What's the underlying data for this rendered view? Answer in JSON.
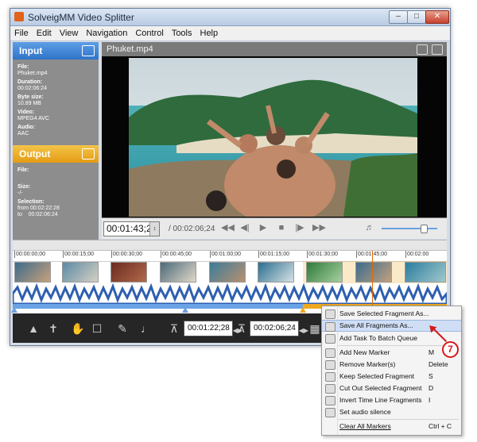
{
  "window": {
    "title": "SolveigMM Video Splitter"
  },
  "menu": [
    "File",
    "Edit",
    "View",
    "Navigation",
    "Control",
    "Tools",
    "Help"
  ],
  "input_panel": {
    "header": "Input",
    "fields": [
      {
        "label": "File:",
        "value": "Phuket.mp4"
      },
      {
        "label": "Duration:",
        "value": "00:02:06:24"
      },
      {
        "label": "Byte size:",
        "value": "10.89 MB"
      },
      {
        "label": "Video:",
        "value": "MPEG4 AVC"
      },
      {
        "label": "Audio:",
        "value": "AAC"
      }
    ]
  },
  "output_panel": {
    "header": "Output",
    "file_label": "File:",
    "size_label": "Size:",
    "size_value": "-/-",
    "selection_label": "Selection:",
    "from_label": "from",
    "from_value": "00:02:22:28",
    "to_label": "to",
    "to_value": "00:02:06:24"
  },
  "player": {
    "filename": "Phuket.mp4",
    "current_time": "00:01:43;26",
    "duration": "/ 00:02:06;24",
    "volume": 0.75
  },
  "timeline": {
    "ticks": [
      "00:00:00;00",
      "00:00:15;00",
      "00:00:30;00",
      "00:00:45;00",
      "00:01:00;00",
      "00:01:15;00",
      "00:01:30;00",
      "00:01:45;00",
      "00:02:00"
    ]
  },
  "bottom_bar": {
    "start_time": "00:01:22;28",
    "end_time": "00:02:06;24"
  },
  "context_menu": {
    "items": [
      {
        "label": "Save Selected Fragment As...",
        "key": "",
        "icon": "save-fragment-icon"
      },
      {
        "label": "Save All Fragments As...",
        "key": "",
        "icon": "save-all-icon",
        "highlighted": true
      },
      {
        "label": "Add Task To Batch Queue",
        "key": "",
        "icon": "batch-icon"
      },
      {
        "label": "Add New Marker",
        "key": "M",
        "icon": "add-marker-icon"
      },
      {
        "label": "Remove Marker(s)",
        "key": "Delete",
        "icon": "remove-marker-icon"
      },
      {
        "label": "Keep Selected Fragment",
        "key": "S",
        "icon": "thumbs-up-icon"
      },
      {
        "label": "Cut Out Selected Fragment",
        "key": "D",
        "icon": "cut-icon"
      },
      {
        "label": "Invert Time Line Fragments",
        "key": "I",
        "icon": "invert-icon"
      },
      {
        "label": "Set audio silence",
        "key": "",
        "icon": "mute-icon"
      },
      {
        "label": "Clear All Markers",
        "key": "Ctrl + C",
        "icon": ""
      }
    ]
  },
  "callout": {
    "number": "7",
    "color": "#d41a1a"
  },
  "colors": {
    "input_header": "#3b82d6",
    "output_header": "#eba91c",
    "selection": "#f0a820",
    "waveform": "#2e5fb0"
  }
}
